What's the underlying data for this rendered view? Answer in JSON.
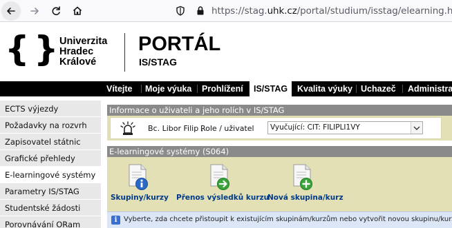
{
  "browser": {
    "url_prefix": "https://stag.",
    "url_domain": "uhk.cz",
    "url_path": "/portal/studium/isstag/elearning.html"
  },
  "header": {
    "uni_line1": "Univerzita",
    "uni_line2": "Hradec",
    "uni_line3": "Králové",
    "portal_title": "PORTÁL",
    "portal_subtitle": "IS/STAG"
  },
  "topmenu": {
    "items": [
      {
        "label": "Vítejte"
      },
      {
        "label": "Moje výuka"
      },
      {
        "label": "Prohlížení"
      },
      {
        "label": "IS/STAG"
      },
      {
        "label": "Kvalita výuky"
      },
      {
        "label": "Uchazeč"
      },
      {
        "label": "Administrace"
      }
    ],
    "active": "IS/STAG"
  },
  "sidebar": {
    "items": [
      {
        "label": "ECTS výjezdy"
      },
      {
        "label": "Požadavky na rozvrh"
      },
      {
        "label": "Zapisovatel státnic"
      },
      {
        "label": "Grafické přehledy"
      },
      {
        "label": "E-learningové systémy"
      },
      {
        "label": "Parametry IS/STAG"
      },
      {
        "label": "Studentské žádosti"
      },
      {
        "label": "Porovnávání ORam"
      }
    ],
    "active": "E-learningové systémy"
  },
  "user_section": {
    "title": "Informace o uživateli a jeho rolích v IS/STAG",
    "user_name": "Bc. Libor Filip ,",
    "role_label": "Role / uživatel",
    "role_value": "Vyučující: CIT: FILIPLI1VY"
  },
  "elearning_section": {
    "title": "E-learningové systémy (S064)",
    "buttons": [
      {
        "label": "Skupiny/kurzy",
        "icon": "document-info-icon"
      },
      {
        "label": "Přenos výsledků kurzu",
        "icon": "document-arrow-icon"
      },
      {
        "label": "Nová skupina/kurz",
        "icon": "document-plus-icon"
      }
    ],
    "info_text": "Vyberte, zda chcete přistoupit k existujícím skupinám/kurzům nebo vytvořit novou skupinu/kurz."
  },
  "colors": {
    "panel_bg": "#e2e0b4",
    "section_head": "#8a8a8a",
    "link_blue": "#003a8c",
    "menu_bg": "#000000"
  }
}
